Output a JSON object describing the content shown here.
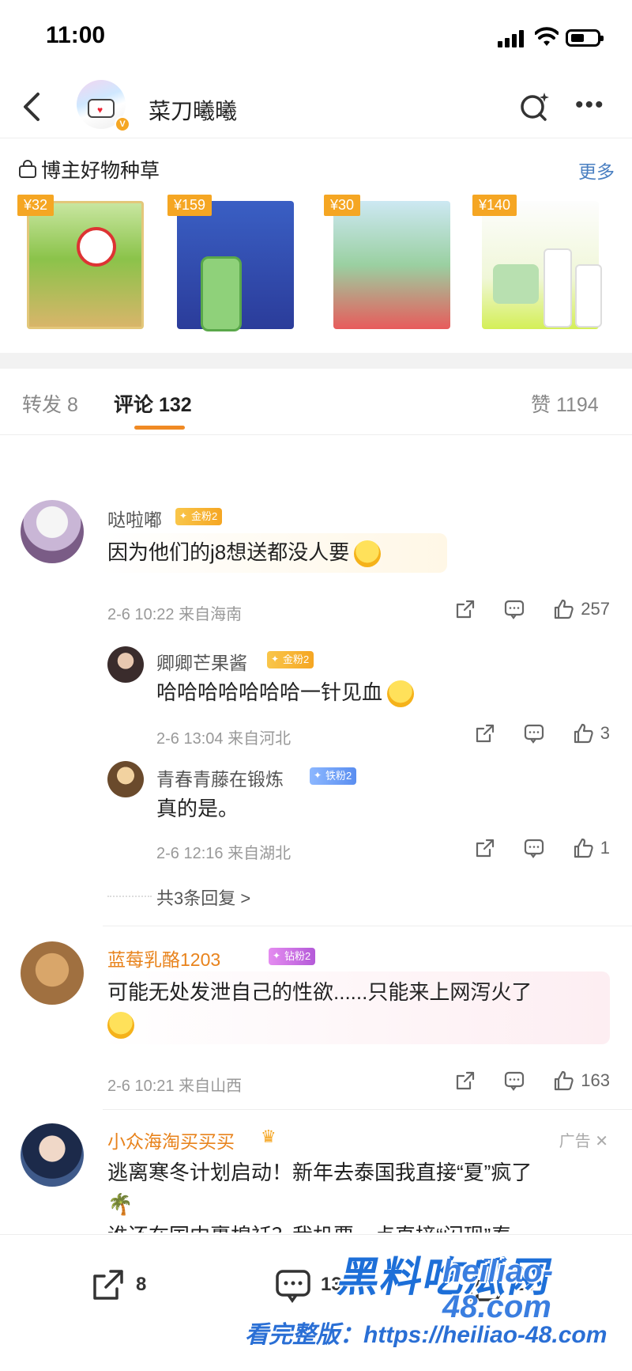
{
  "status_bar": {
    "time": "11:00"
  },
  "nav": {
    "title": "菜刀曦曦"
  },
  "goods": {
    "header": "博主好物种草",
    "more": "更多",
    "products": [
      {
        "price": "¥32"
      },
      {
        "price": "¥159"
      },
      {
        "price": "¥30"
      },
      {
        "price": "¥140"
      }
    ]
  },
  "tabs": {
    "repost": "转发 8",
    "comments": "评论 132",
    "likes": "赞 1194"
  },
  "comments": [
    {
      "user": "哒啦嘟",
      "badge": "金粉2",
      "text": "因为他们的j8想送都没人要",
      "meta": "2-6 10:22  来自海南",
      "likes": "257",
      "replies": [
        {
          "user": "卿卿芒果酱",
          "badge": "金粉2",
          "text": "哈哈哈哈哈哈哈一针见血",
          "meta": "2-6 13:04  来自河北",
          "likes": "3"
        },
        {
          "user": "青春青藤在锻炼",
          "badge": "铁粉2",
          "text": "真的是。",
          "meta": "2-6 12:16  来自湖北",
          "likes": "1"
        }
      ],
      "more_replies": "共3条回复 >"
    },
    {
      "user": "蓝莓乳酪1203",
      "badge": "钻粉2",
      "text": "可能无处发泄自己的性欲......只能来上网泻火了",
      "meta": "2-6 10:21  来自山西",
      "likes": "163"
    },
    {
      "user": "小众海淘买买买",
      "ad": "广告",
      "text1": "逃离寒冬计划启动！新年去泰国我直接“夏”疯了",
      "text2": "谁还在国内裹棉袄？我机票一点直接“闪现”泰"
    }
  ],
  "toolbar": {
    "repost_count": "8",
    "comment_count": "13",
    "like_count": "11"
  },
  "watermark": {
    "brand": "黑料吃瓜网",
    "domain": "heiliao-48.com",
    "line": "看完整版：https://heiliao-48.com"
  }
}
